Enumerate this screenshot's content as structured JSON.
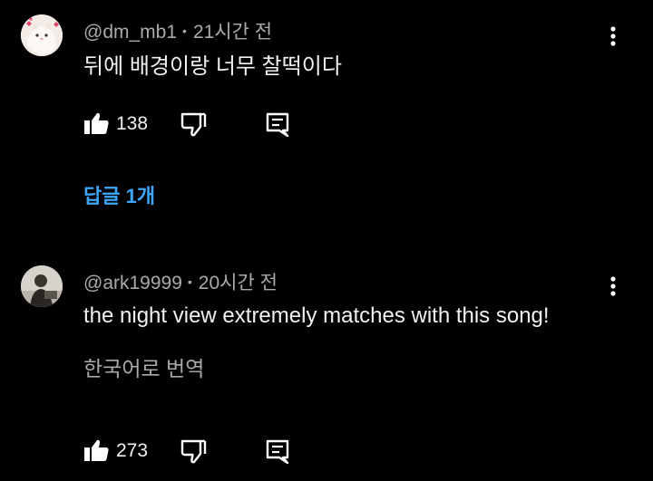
{
  "comments": [
    {
      "author": "@dm_mb1",
      "separator": "•",
      "time": "21시간 전",
      "text": "뒤에 배경이랑 너무 찰떡이다",
      "likes": "138",
      "replies_label": "답글 1개",
      "avatar_icon": "cat-avatar"
    },
    {
      "author": "@ark19999",
      "separator": "•",
      "time": "20시간 전",
      "text": "the night view extremely matches with this song!",
      "translate_label": "한국어로 번역",
      "likes": "273",
      "avatar_icon": "person-avatar"
    }
  ],
  "icons": {
    "like": "thumbs-up-icon",
    "dislike": "thumbs-down-icon",
    "reply": "reply-comment-icon",
    "more": "more-vertical-icon"
  },
  "colors": {
    "background": "#000000",
    "link": "#3ea6ff",
    "secondary_text": "#aaaaaa"
  }
}
